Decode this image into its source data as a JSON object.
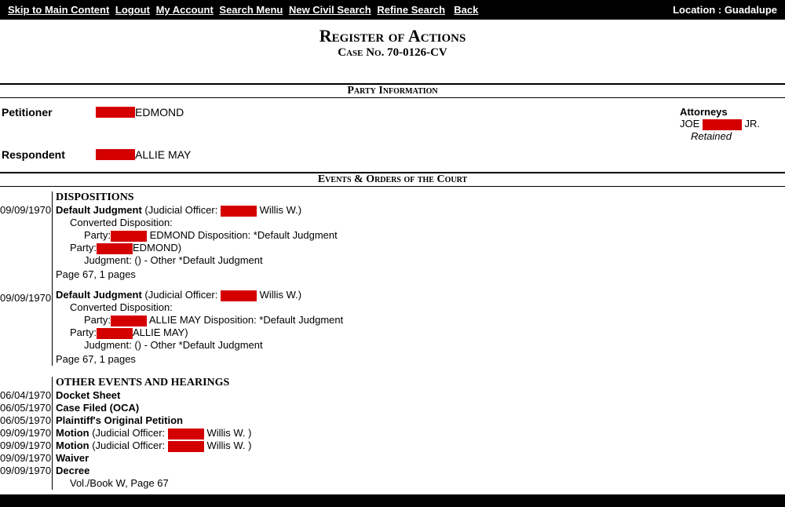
{
  "topnav": {
    "links": [
      "Skip to Main Content",
      "Logout",
      "My Account",
      "Search Menu",
      "New Civil Search",
      "Refine Search",
      "Back"
    ],
    "location_label": "Location :",
    "location_value": "Guadalupe"
  },
  "header": {
    "title": "Register of Actions",
    "case_label": "Case No.",
    "case_no": "70-0126-CV"
  },
  "section_party": "Party Information",
  "parties": {
    "petitioner_label": "Petitioner",
    "petitioner_name": "EDMOND",
    "respondent_label": "Respondent",
    "respondent_name": "ALLIE MAY"
  },
  "attorneys": {
    "heading": "Attorneys",
    "name_prefix": "JOE",
    "name_suffix": "JR.",
    "retained": "Retained"
  },
  "section_events": "Events & Orders of the Court",
  "dispositions": {
    "heading": "DISPOSITIONS",
    "items": [
      {
        "date": "09/09/1970",
        "title": "Default Judgment",
        "officer_label": "(Judicial Officer:",
        "officer_name": "Willis W.)",
        "converted": "Converted Disposition:",
        "party1_label": "Party:",
        "party1_name": "EDMOND Disposition: *Default Judgment",
        "party2_label": "Party:",
        "party2_name": "EDMOND)",
        "judgment": "Judgment: () - Other *Default Judgment",
        "page": "Page 67,  1 pages"
      },
      {
        "date": "09/09/1970",
        "title": "Default Judgment",
        "officer_label": "(Judicial Officer:",
        "officer_name": "Willis W.)",
        "converted": "Converted Disposition:",
        "party1_label": "Party:",
        "party1_name": "ALLIE MAY Disposition: *Default Judgment",
        "party2_label": "Party:",
        "party2_name": "ALLIE MAY)",
        "judgment": "Judgment: () - Other *Default Judgment",
        "page": "Page 67,  1 pages"
      }
    ]
  },
  "other_events": {
    "heading": "OTHER EVENTS AND HEARINGS",
    "items": [
      {
        "date": "06/04/1970",
        "title": "Docket Sheet",
        "detail": ""
      },
      {
        "date": "06/05/1970",
        "title": "Case Filed (OCA)",
        "detail": ""
      },
      {
        "date": "06/05/1970",
        "title": "Plaintiff's Original Petition",
        "detail": ""
      },
      {
        "date": "09/09/1970",
        "title": "Motion",
        "detail": "(Judicial Officer:",
        "officer": "Willis W. )"
      },
      {
        "date": "09/09/1970",
        "title": "Motion",
        "detail": "(Judicial Officer:",
        "officer": "Willis W. )"
      },
      {
        "date": "09/09/1970",
        "title": "Waiver",
        "detail": ""
      },
      {
        "date": "09/09/1970",
        "title": "Decree",
        "detail": ""
      }
    ],
    "volbook": "Vol./Book W, Page 67"
  }
}
